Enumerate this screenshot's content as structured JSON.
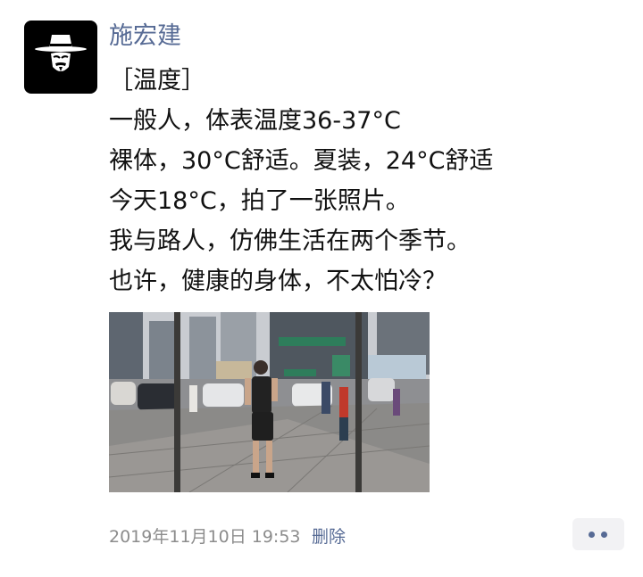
{
  "post": {
    "author": "施宏建",
    "lines": [
      "［温度］",
      "一般人，体表温度36-37°C",
      "裸体，30°C舒适。夏装，24°C舒适",
      "今天18°C，拍了一张照片。",
      "我与路人，仿佛生活在两个季节。",
      "也许，健康的身体，不太怕冷？"
    ],
    "timestamp": "2019年11月10日 19:53",
    "delete_label": "删除"
  },
  "icons": {
    "avatar": "masked-man-hat-avatar",
    "more": "more-dots-icon"
  },
  "colors": {
    "link": "#576b95",
    "meta": "#8c8c8c",
    "text": "#111111",
    "more_bg": "#f2f2f4"
  }
}
